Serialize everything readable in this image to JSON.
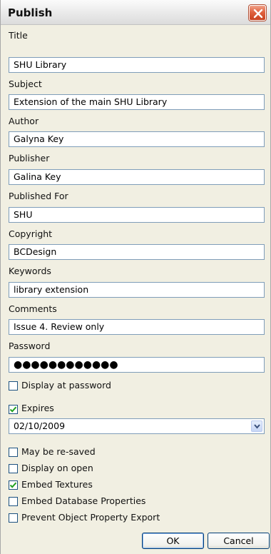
{
  "window": {
    "title": "Publish"
  },
  "fields": {
    "title": {
      "label": "Title",
      "value": "SHU Library"
    },
    "subject": {
      "label": "Subject",
      "value": "Extension of the main SHU Library"
    },
    "author": {
      "label": "Author",
      "value": "Galyna Key"
    },
    "publisher": {
      "label": "Publisher",
      "value": "Galina Key"
    },
    "published_for": {
      "label": "Published For",
      "value": "SHU"
    },
    "copyright": {
      "label": "Copyright",
      "value": "BCDesign"
    },
    "keywords": {
      "label": "Keywords",
      "value": "library extension"
    },
    "comments": {
      "label": "Comments",
      "value": "Issue 4. Review only"
    },
    "password": {
      "label": "Password",
      "value": "●●●●●●●●●●●●"
    }
  },
  "display_at_password": {
    "label": "Display at password",
    "checked": false
  },
  "expires": {
    "label": "Expires",
    "checked": true,
    "date": "02/10/2009"
  },
  "options": [
    {
      "label": "May be re-saved",
      "checked": false
    },
    {
      "label": "Display on open",
      "checked": false
    },
    {
      "label": "Embed Textures",
      "checked": true
    },
    {
      "label": "Embed Database Properties",
      "checked": false
    },
    {
      "label": "Prevent Object Property Export",
      "checked": false
    }
  ],
  "buttons": {
    "ok": "OK",
    "cancel": "Cancel"
  },
  "icons": {
    "close": "close-icon",
    "dropdown": "chevron-down-icon",
    "check": "check-icon"
  },
  "colors": {
    "close_button": "#d9532f",
    "input_border": "#7f9db9",
    "check_mark": "#21a121",
    "dialog_bg": "#f1efe2"
  }
}
